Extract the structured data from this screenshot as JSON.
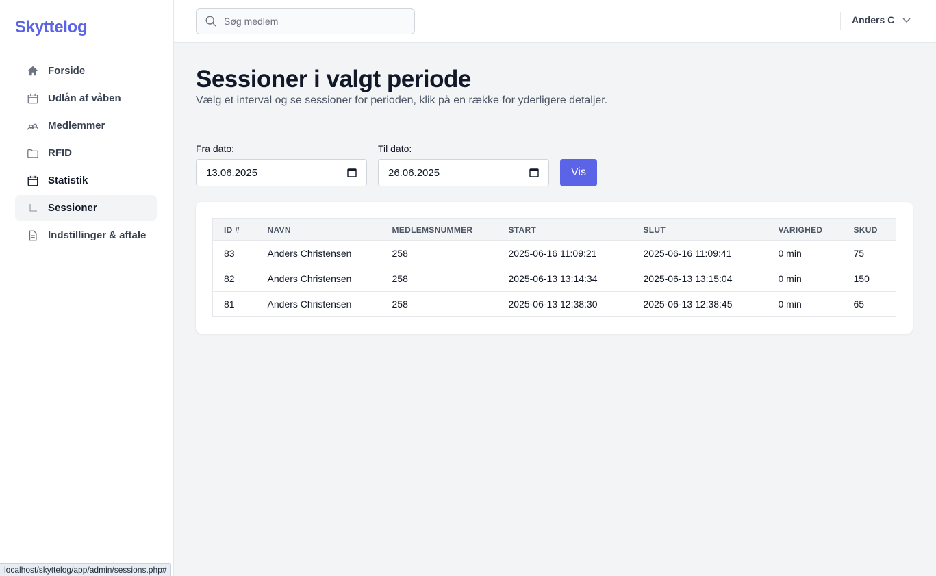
{
  "brand": "Skyttelog",
  "sidebar": {
    "items": [
      {
        "label": "Forside",
        "icon": "home-icon"
      },
      {
        "label": "Udlån af våben",
        "icon": "calendar-icon"
      },
      {
        "label": "Medlemmer",
        "icon": "users-icon"
      },
      {
        "label": "RFID",
        "icon": "folder-icon"
      },
      {
        "label": "Statistik",
        "icon": "calendar-icon"
      },
      {
        "label": "Sessioner",
        "icon": "corner-icon"
      },
      {
        "label": "Indstillinger & aftale",
        "icon": "document-icon"
      }
    ]
  },
  "header": {
    "search_placeholder": "Søg medlem",
    "user_name": "Anders C"
  },
  "main": {
    "title": "Sessioner i valgt periode",
    "subtitle": "Vælg et interval og se sessioner for perioden, klik på en række for yderligere detaljer.",
    "from_label": "Fra dato:",
    "from_value": "13.06.2025",
    "to_label": "Til dato:",
    "to_value": "26.06.2025",
    "submit_label": "Vis"
  },
  "table": {
    "headers": [
      "ID #",
      "NAVN",
      "MEDLEMSNUMMER",
      "START",
      "SLUT",
      "VARIGHED",
      "SKUD"
    ],
    "rows": [
      [
        "83",
        "Anders Christensen",
        "258",
        "2025-06-16 11:09:21",
        "2025-06-16 11:09:41",
        "0 min",
        "75"
      ],
      [
        "82",
        "Anders Christensen",
        "258",
        "2025-06-13 13:14:34",
        "2025-06-13 13:15:04",
        "0 min",
        "150"
      ],
      [
        "81",
        "Anders Christensen",
        "258",
        "2025-06-13 12:38:30",
        "2025-06-13 12:38:45",
        "0 min",
        "65"
      ]
    ]
  },
  "status_bar_url": "localhost/skyttelog/app/admin/sessions.php#",
  "colors": {
    "accent": "#5b63e6",
    "background": "#f3f4f6"
  }
}
